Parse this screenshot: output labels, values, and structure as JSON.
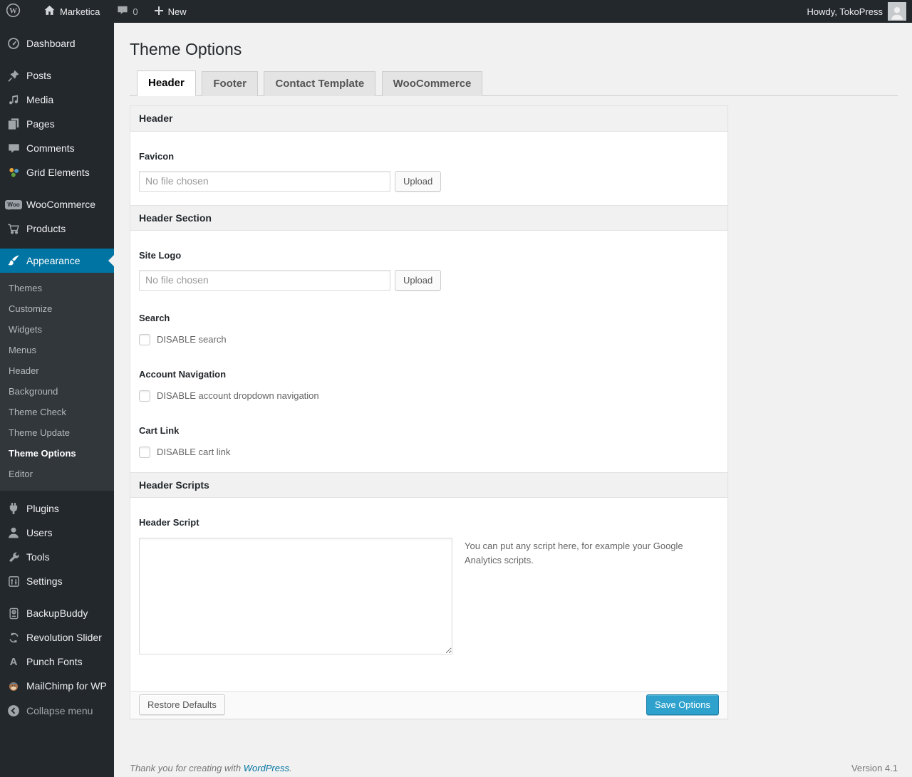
{
  "admin_bar": {
    "site_name": "Marketica",
    "comment_count": "0",
    "new_label": "New",
    "howdy": "Howdy, TokoPress"
  },
  "sidebar": {
    "items": [
      {
        "label": "Dashboard",
        "icon": "dashboard-icon"
      },
      {
        "label": "Posts",
        "icon": "pin-icon"
      },
      {
        "label": "Media",
        "icon": "media-icon"
      },
      {
        "label": "Pages",
        "icon": "pages-icon"
      },
      {
        "label": "Comments",
        "icon": "comments-icon"
      },
      {
        "label": "Grid Elements",
        "icon": "grid-elements-icon"
      },
      {
        "label": "WooCommerce",
        "icon": "woocommerce-badge-icon",
        "badge": "Woo"
      },
      {
        "label": "Products",
        "icon": "cart-icon"
      },
      {
        "label": "Appearance",
        "icon": "appearance-brush-icon",
        "active": true
      },
      {
        "label": "Plugins",
        "icon": "plugin-icon"
      },
      {
        "label": "Users",
        "icon": "users-icon"
      },
      {
        "label": "Tools",
        "icon": "wrench-icon"
      },
      {
        "label": "Settings",
        "icon": "settings-icon"
      },
      {
        "label": "BackupBuddy",
        "icon": "backup-drive-icon"
      },
      {
        "label": "Revolution Slider",
        "icon": "refresh-icon"
      },
      {
        "label": "Punch Fonts",
        "icon": "letter-a-icon",
        "icon_letter": "A"
      },
      {
        "label": "MailChimp for WP",
        "icon": "mailchimp-monkey-icon"
      },
      {
        "label": "Collapse menu",
        "icon": "collapse-arrow-icon"
      }
    ],
    "submenu": [
      {
        "label": "Themes"
      },
      {
        "label": "Customize"
      },
      {
        "label": "Widgets"
      },
      {
        "label": "Menus"
      },
      {
        "label": "Header"
      },
      {
        "label": "Background"
      },
      {
        "label": "Theme Check"
      },
      {
        "label": "Theme Update"
      },
      {
        "label": "Theme Options",
        "current": true
      },
      {
        "label": "Editor"
      }
    ]
  },
  "page": {
    "title": "Theme Options",
    "tabs": [
      {
        "label": "Header",
        "active": true
      },
      {
        "label": "Footer"
      },
      {
        "label": "Contact Template"
      },
      {
        "label": "WooCommerce"
      }
    ]
  },
  "panel": {
    "title": "Header",
    "favicon": {
      "label": "Favicon",
      "value": "No file chosen",
      "button": "Upload"
    },
    "sections": {
      "header_section": "Header Section",
      "header_scripts": "Header Scripts"
    },
    "site_logo": {
      "label": "Site Logo",
      "value": "No file chosen",
      "button": "Upload"
    },
    "search": {
      "label": "Search",
      "checkbox": "DISABLE search"
    },
    "account": {
      "label": "Account Navigation",
      "checkbox": "DISABLE account dropdown navigation"
    },
    "cart": {
      "label": "Cart Link",
      "checkbox": "DISABLE cart link"
    },
    "script": {
      "label": "Header Script",
      "note": "You can put any script here, for example your Google Analytics scripts."
    },
    "footer": {
      "restore": "Restore Defaults",
      "save": "Save Options"
    }
  },
  "footer": {
    "thanks_prefix": "Thank you for creating with ",
    "link": "WordPress",
    "suffix": ".",
    "version": "Version 4.1"
  },
  "colors": {
    "adminbar_bg": "#23282d",
    "menu_bg": "#23282d",
    "submenu_bg": "#32373c",
    "active_accent": "#0074a2",
    "content_bg": "#f1f1f1",
    "primary_button": "#2ea2cc",
    "link_blue": "#0074a2"
  }
}
